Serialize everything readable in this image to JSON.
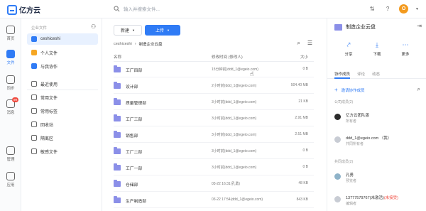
{
  "topbar": {
    "logo_text": "亿方云",
    "search_placeholder": "输入并搜索文件..."
  },
  "avatar_letter": "O",
  "rail": [
    {
      "label": "首页",
      "icon": "home-icon"
    },
    {
      "label": "文件",
      "icon": "folder-icon",
      "active": true
    },
    {
      "label": "同步",
      "icon": "sync-icon"
    },
    {
      "label": "消息",
      "icon": "message-icon",
      "badge": "99"
    },
    {
      "label": "管理",
      "icon": "admin-icon"
    },
    {
      "label": "应用",
      "icon": "apps-icon"
    }
  ],
  "tree": {
    "head": "企业文件",
    "items": [
      {
        "label": "ceshiceshi",
        "color": "#2f7bf5",
        "active": true
      },
      {
        "label": "个人文件",
        "color": "#f5a623"
      },
      {
        "label": "与我协作",
        "color": "#2f7bf5"
      },
      {
        "label": "最近使用"
      },
      {
        "label": "常用文件"
      },
      {
        "label": "常用标签"
      },
      {
        "label": "回收站"
      },
      {
        "label": "隔离区"
      },
      {
        "label": "敏感文件"
      }
    ]
  },
  "main": {
    "new_label": "新建",
    "upload_label": "上传",
    "crumb_root": "ceshiceshi",
    "crumb_current": "制造企业云盘",
    "col_name": "名称",
    "col_time": "修改时间 (修改人)",
    "col_size": "大小",
    "rows": [
      {
        "name": "工厂四部",
        "time": "15分钟前(ddd_1@egeio.com)",
        "size": "0 B"
      },
      {
        "name": "设计部",
        "time": "2小时前(ddd_1@egeio.com)",
        "size": "504.40 MB"
      },
      {
        "name": "质量管理部",
        "time": "3小时前(ddd_1@egeio.com)",
        "size": "21 KB"
      },
      {
        "name": "工厂三部",
        "time": "3小时前(ddd_1@egeio.com)",
        "size": "2.91 MB"
      },
      {
        "name": "销售部",
        "time": "3小时前(ddd_1@egeio.com)",
        "size": "2.51 MB"
      },
      {
        "name": "工厂二部",
        "time": "3小时前(ddd_1@egeio.com)",
        "size": "0 B"
      },
      {
        "name": "工厂一部",
        "time": "3小时前(ddd_1@egeio.com)",
        "size": "0 B"
      },
      {
        "name": "仓储部",
        "time": "03-22 16:31(孔勇)",
        "size": "48 KB"
      },
      {
        "name": "生产制造部",
        "time": "03-22 17:54(ddd_1@egeio.com)",
        "size": "843 KB"
      }
    ]
  },
  "panel": {
    "title": "制造企业云盘",
    "actions": [
      {
        "label": "分享",
        "icon": "share-icon"
      },
      {
        "label": "下载",
        "icon": "download-icon"
      },
      {
        "label": "更多",
        "icon": "more-icon"
      }
    ],
    "tabs": [
      "协作成员",
      "评论",
      "动态"
    ],
    "invite": "邀请协作成员",
    "group_company": "公司成员(2)",
    "group_shared": "共同成员(2)",
    "members": [
      {
        "name": "亿方云团队版",
        "role": "所有者",
        "avatar": "#2b2b2b"
      },
      {
        "name": "ddd_1@egeio.com （我）",
        "role": "共同所有者",
        "avatar": "#c8ccd4"
      },
      {
        "name": "孔勇",
        "role": "预览者",
        "avatar": "#8fb3c9"
      },
      {
        "name": "13777579767(未激活)",
        "tag": "(未接受)",
        "role": "编辑者",
        "avatar": "#c8ccd4"
      }
    ]
  }
}
